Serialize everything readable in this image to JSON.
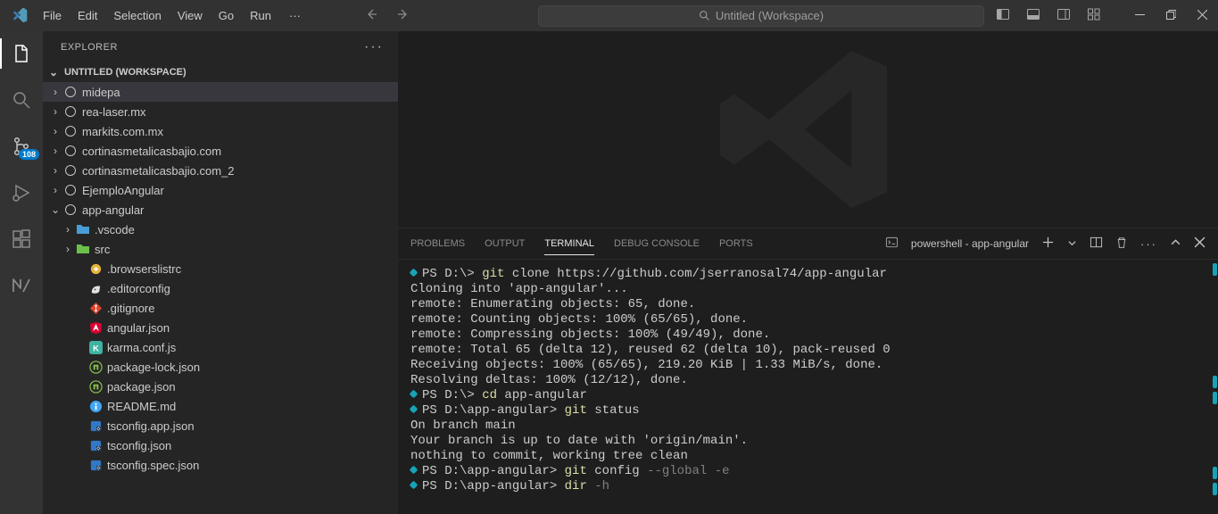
{
  "titlebar": {
    "menu": [
      "File",
      "Edit",
      "Selection",
      "View",
      "Go",
      "Run"
    ],
    "command_center": "Untitled (Workspace)"
  },
  "activitybar": {
    "badge_source_control": "108"
  },
  "sidebar": {
    "title": "EXPLORER",
    "section": "UNTITLED (WORKSPACE)",
    "items": [
      {
        "type": "folder",
        "name": "midepa",
        "depth": 1,
        "chev": "›",
        "icon": "circle",
        "active": true,
        "dirty": true
      },
      {
        "type": "folder",
        "name": "rea-laser.mx",
        "depth": 1,
        "chev": "›",
        "icon": "circle"
      },
      {
        "type": "folder",
        "name": "markits.com.mx",
        "depth": 1,
        "chev": "›",
        "icon": "circle"
      },
      {
        "type": "folder",
        "name": "cortinasmetalicasbajio.com",
        "depth": 1,
        "chev": "›",
        "icon": "circle"
      },
      {
        "type": "folder",
        "name": "cortinasmetalicasbajio.com_2",
        "depth": 1,
        "chev": "›",
        "icon": "circle"
      },
      {
        "type": "folder",
        "name": "EjemploAngular",
        "depth": 1,
        "chev": "›",
        "icon": "circle"
      },
      {
        "type": "folder",
        "name": "app-angular",
        "depth": 1,
        "chev": "⌄",
        "icon": "circle-open"
      },
      {
        "type": "folder",
        "name": ".vscode",
        "depth": 2,
        "chev": "›",
        "icon": "folder-blue"
      },
      {
        "type": "folder",
        "name": "src",
        "depth": 2,
        "chev": "›",
        "icon": "folder-green"
      },
      {
        "type": "file",
        "name": ".browserslistrc",
        "depth": 3,
        "icon": "browserslist"
      },
      {
        "type": "file",
        "name": ".editorconfig",
        "depth": 3,
        "icon": "editorconfig"
      },
      {
        "type": "file",
        "name": ".gitignore",
        "depth": 3,
        "icon": "git"
      },
      {
        "type": "file",
        "name": "angular.json",
        "depth": 3,
        "icon": "angular"
      },
      {
        "type": "file",
        "name": "karma.conf.js",
        "depth": 3,
        "icon": "karma"
      },
      {
        "type": "file",
        "name": "package-lock.json",
        "depth": 3,
        "icon": "npm"
      },
      {
        "type": "file",
        "name": "package.json",
        "depth": 3,
        "icon": "npm"
      },
      {
        "type": "file",
        "name": "README.md",
        "depth": 3,
        "icon": "info"
      },
      {
        "type": "file",
        "name": "tsconfig.app.json",
        "depth": 3,
        "icon": "tsconfig"
      },
      {
        "type": "file",
        "name": "tsconfig.json",
        "depth": 3,
        "icon": "tsconfig"
      },
      {
        "type": "file",
        "name": "tsconfig.spec.json",
        "depth": 3,
        "icon": "tsconfig"
      }
    ]
  },
  "panel": {
    "tabs": [
      "PROBLEMS",
      "OUTPUT",
      "TERMINAL",
      "DEBUG CONSOLE",
      "PORTS"
    ],
    "active_tab": "TERMINAL",
    "shell_label": "powershell - app-angular"
  },
  "terminal": {
    "lines": [
      {
        "prompt": "PS D:\\> ",
        "cmd": "git",
        "rest": " clone https://github.com/jserranosal74/app-angular"
      },
      {
        "plain": "Cloning into 'app-angular'..."
      },
      {
        "plain": "remote: Enumerating objects: 65, done."
      },
      {
        "plain": "remote: Counting objects: 100% (65/65), done."
      },
      {
        "plain": "remote: Compressing objects: 100% (49/49), done."
      },
      {
        "plain": "remote: Total 65 (delta 12), reused 62 (delta 10), pack-reused 0"
      },
      {
        "plain": "Receiving objects: 100% (65/65), 219.20 KiB | 1.33 MiB/s, done."
      },
      {
        "plain": "Resolving deltas: 100% (12/12), done."
      },
      {
        "prompt": "PS D:\\> ",
        "cmd": "cd",
        "rest": " app-angular"
      },
      {
        "prompt": "PS D:\\app-angular> ",
        "cmd": "git",
        "rest": " status"
      },
      {
        "plain": "On branch main"
      },
      {
        "plain": "Your branch is up to date with 'origin/main'."
      },
      {
        "plain": ""
      },
      {
        "plain": "nothing to commit, working tree clean"
      },
      {
        "prompt": "PS D:\\app-angular> ",
        "cmd": "git",
        "rest": " config ",
        "flags": "--global -e"
      },
      {
        "prompt": "PS D:\\app-angular> ",
        "cmd": "dir",
        "rest": " ",
        "flags": "-h"
      }
    ]
  }
}
